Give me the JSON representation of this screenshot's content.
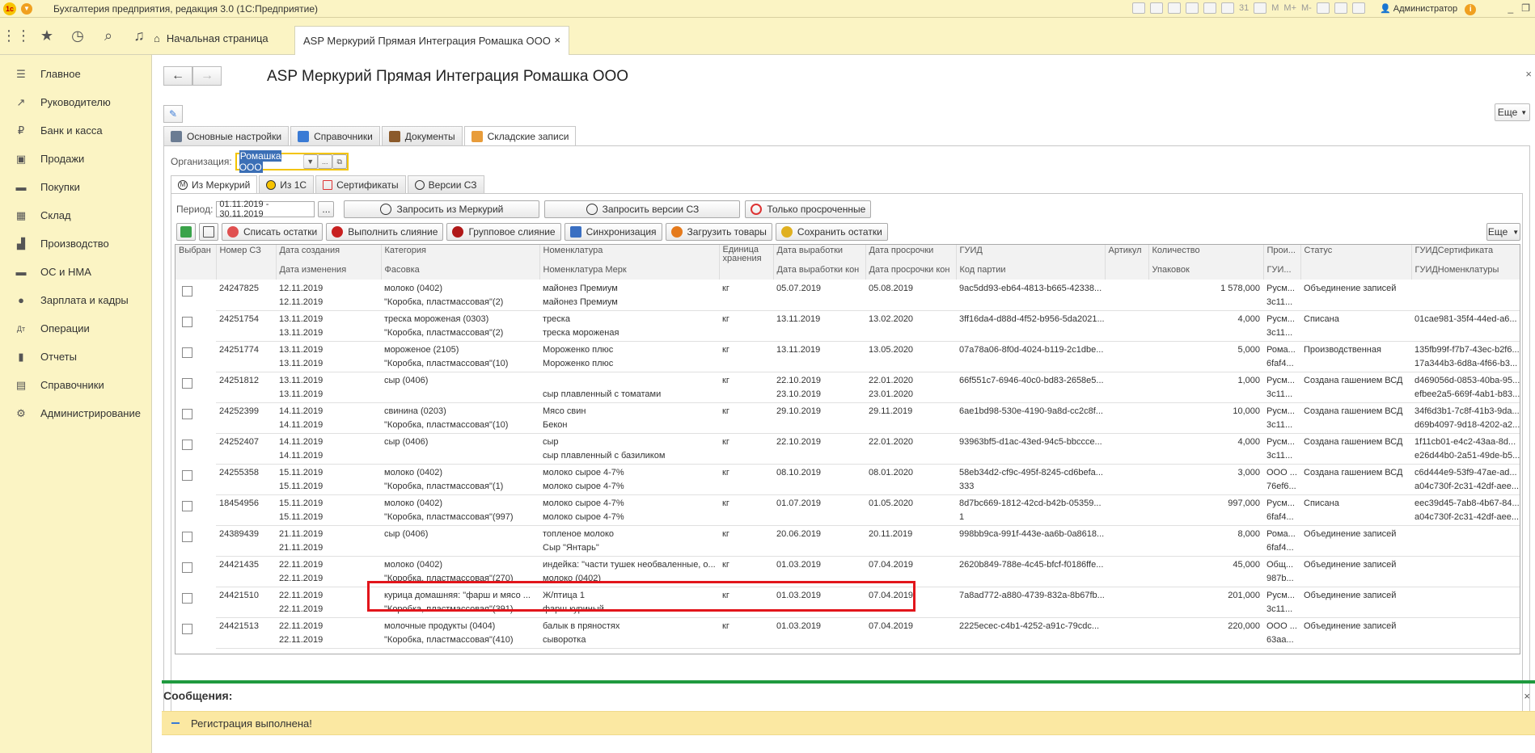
{
  "app": {
    "title": "Бухгалтерия предприятия, редакция 3.0  (1С:Предприятие)",
    "logo": "1с",
    "user": "Администратор",
    "mem_labels": [
      "M",
      "M+",
      "M-"
    ],
    "calendar": "31"
  },
  "tabs": {
    "home": "Начальная страница",
    "active": "ASP Меркурий Прямая Интеграция Ромашка ООО",
    "close": "×"
  },
  "sidebar": {
    "items": [
      {
        "label": "Главное",
        "icon": "☰"
      },
      {
        "label": "Руководителю",
        "icon": "↗"
      },
      {
        "label": "Банк и касса",
        "icon": "₽"
      },
      {
        "label": "Продажи",
        "icon": "▣"
      },
      {
        "label": "Покупки",
        "icon": "▬"
      },
      {
        "label": "Склад",
        "icon": "▦"
      },
      {
        "label": "Производство",
        "icon": "▟"
      },
      {
        "label": "ОС и НМА",
        "icon": "▬"
      },
      {
        "label": "Зарплата и кадры",
        "icon": "●"
      },
      {
        "label": "Операции",
        "icon": "Дт"
      },
      {
        "label": "Отчеты",
        "icon": "▮"
      },
      {
        "label": "Справочники",
        "icon": "▤"
      },
      {
        "label": "Администрирование",
        "icon": "⚙"
      }
    ]
  },
  "form": {
    "title": "ASP Меркурий Прямая Интеграция Ромашка ООО",
    "more_label": "Еще",
    "tabs": [
      "Основные настройки",
      "Справочники",
      "Документы",
      "Складские записи"
    ],
    "org_label": "Организация:",
    "org_value": "Ромашка ООО",
    "subtabs": [
      "Из Меркурий",
      "Из 1С",
      "Сертификаты",
      "Версии СЗ"
    ],
    "period_label": "Период:",
    "period_value": "01.11.2019 - 30.11.2019",
    "ellipsis": "...",
    "btn_request_mercury": "Запросить из Меркурий",
    "btn_request_versions": "Запросить версии СЗ",
    "btn_only_expired": "Только просроченные",
    "cmd": {
      "write_off": "Списать остатки",
      "merge": "Выполнить слияние",
      "group_merge": "Групповое слияние",
      "sync": "Синхронизация",
      "load_goods": "Загрузить товары",
      "save_remains": "Сохранить остатки",
      "more": "Еще"
    }
  },
  "grid": {
    "headers_top": [
      "Выбран",
      "Номер СЗ",
      "Дата создания",
      "Категория",
      "Номенклатура",
      "Единица хранения",
      "Дата выработки",
      "Дата просрочки",
      "ГУИД",
      "Артикул",
      "Количество",
      "Прои...",
      "Статус",
      "ГУИДСертификата"
    ],
    "headers_bottom": [
      "",
      "",
      "Дата изменения",
      "Фасовка",
      "Номенклатура Мерк",
      "",
      "Дата выработки кон",
      "Дата просрочки кон",
      "Код партии",
      "",
      "Упаковок",
      "ГУИ...",
      "",
      "ГУИДНоменклатуры"
    ],
    "rows": [
      {
        "a": [
          "24247825",
          "12.11.2019",
          "молоко (0402)",
          "майонез Премиум",
          "кг",
          "05.07.2019",
          "05.08.2019",
          "9ac5dd93-eb64-4813-b665-42338...",
          "",
          "1 578,000",
          "Русм...",
          "Объединение записей",
          ""
        ],
        "b": [
          "",
          "12.11.2019",
          "\"Коробка, пластмассовая\"(2)",
          "майонез Премиум",
          "",
          "",
          "",
          "",
          "",
          "",
          "3с11...",
          "",
          ""
        ]
      },
      {
        "a": [
          "24251754",
          "13.11.2019",
          "треска мороженая (0303)",
          "треска",
          "кг",
          "13.11.2019",
          "13.02.2020",
          "3ff16da4-d88d-4f52-b956-5da2021...",
          "",
          "4,000",
          "Русм...",
          "Списана",
          "01cae981-35f4-44ed-a6..."
        ],
        "b": [
          "",
          "13.11.2019",
          "\"Коробка, пластмассовая\"(2)",
          "треска мороженая",
          "",
          "",
          "",
          "",
          "",
          "",
          "3с11...",
          "",
          ""
        ]
      },
      {
        "a": [
          "24251774",
          "13.11.2019",
          "мороженое (2105)",
          "Мороженко плюс",
          "кг",
          "13.11.2019",
          "13.05.2020",
          "07a78a06-8f0d-4024-b119-2c1dbe...",
          "",
          "5,000",
          "Рома...",
          "Производственная",
          "135fb99f-f7b7-43ec-b2f6..."
        ],
        "b": [
          "",
          "13.11.2019",
          "\"Коробка, пластмассовая\"(10)",
          "Мороженко плюс",
          "",
          "",
          "",
          "",
          "",
          "",
          "6faf4...",
          "",
          "17a344b3-6d8a-4f66-b3..."
        ]
      },
      {
        "a": [
          "24251812",
          "13.11.2019",
          "сыр (0406)",
          "",
          "кг",
          "22.10.2019",
          "22.01.2020",
          "66f551c7-6946-40c0-bd83-2658e5...",
          "",
          "1,000",
          "Русм...",
          "Создана гашением ВСД",
          "d469056d-0853-40ba-95..."
        ],
        "b": [
          "",
          "13.11.2019",
          "",
          "сыр плавленный с томатами",
          "",
          "23.10.2019",
          "23.01.2020",
          "",
          "",
          "",
          "3с11...",
          "",
          "efbee2a5-669f-4ab1-b83..."
        ]
      },
      {
        "a": [
          "24252399",
          "14.11.2019",
          "свинина (0203)",
          "Мясо свин",
          "кг",
          "29.10.2019",
          "29.11.2019",
          "6ae1bd98-530e-4190-9a8d-cc2c8f...",
          "",
          "10,000",
          "Русм...",
          "Создана гашением ВСД",
          "34f6d3b1-7c8f-41b3-9da..."
        ],
        "b": [
          "",
          "14.11.2019",
          "\"Коробка, пластмассовая\"(10)",
          "Бекон",
          "",
          "",
          "",
          "",
          "",
          "",
          "3с11...",
          "",
          "d69b4097-9d18-4202-a2..."
        ]
      },
      {
        "a": [
          "24252407",
          "14.11.2019",
          "сыр (0406)",
          "сыр",
          "кг",
          "22.10.2019",
          "22.01.2020",
          "93963bf5-d1ac-43ed-94c5-bbccce...",
          "",
          "4,000",
          "Русм...",
          "Создана гашением ВСД",
          "1f11cb01-e4c2-43aa-8d..."
        ],
        "b": [
          "",
          "14.11.2019",
          "",
          "сыр плавленный с базиликом",
          "",
          "",
          "",
          "",
          "",
          "",
          "3с11...",
          "",
          "e26d44b0-2a51-49de-b5..."
        ]
      },
      {
        "a": [
          "24255358",
          "15.11.2019",
          "молоко (0402)",
          "молоко сырое 4-7%",
          "кг",
          "08.10.2019",
          "08.01.2020",
          "58eb34d2-cf9c-495f-8245-cd6befa...",
          "",
          "3,000",
          "ООО ...",
          "Создана гашением ВСД",
          "c6d444e9-53f9-47ae-ad..."
        ],
        "b": [
          "",
          "15.11.2019",
          "\"Коробка, пластмассовая\"(1)",
          "молоко сырое 4-7%",
          "",
          "",
          "",
          "333",
          "",
          "",
          "76ef6...",
          "",
          "a04c730f-2c31-42df-aee..."
        ]
      },
      {
        "a": [
          "18454956",
          "15.11.2019",
          "молоко (0402)",
          "молоко сырое 4-7%",
          "кг",
          "01.07.2019",
          "01.05.2020",
          "8d7bc669-1812-42cd-b42b-05359...",
          "",
          "997,000",
          "Русм...",
          "Списана",
          "eec39d45-7ab8-4b67-84..."
        ],
        "b": [
          "",
          "15.11.2019",
          "\"Коробка, пластмассовая\"(997)",
          "молоко сырое 4-7%",
          "",
          "",
          "",
          "1",
          "",
          "",
          "6faf4...",
          "",
          "a04c730f-2c31-42df-aee..."
        ]
      },
      {
        "a": [
          "24389439",
          "21.11.2019",
          "сыр (0406)",
          "топленое молоко",
          "кг",
          "20.06.2019",
          "20.11.2019",
          "998bb9ca-991f-443e-aa6b-0a8618...",
          "",
          "8,000",
          "Рома...",
          "Объединение записей",
          ""
        ],
        "b": [
          "",
          "21.11.2019",
          "",
          "Сыр \"Янтарь\"",
          "",
          "",
          "",
          "",
          "",
          "",
          "6faf4...",
          "",
          ""
        ]
      },
      {
        "a": [
          "24421435",
          "22.11.2019",
          "молоко (0402)",
          "индейка: \"части тушек необваленные, о...",
          "кг",
          "01.03.2019",
          "07.04.2019",
          "2620b849-788e-4c45-bfcf-f0186ffe...",
          "",
          "45,000",
          "Общ...",
          "Объединение записей",
          ""
        ],
        "b": [
          "",
          "22.11.2019",
          "\"Коробка, пластмассовая\"(270)",
          "молоко (0402)",
          "",
          "",
          "",
          "",
          "",
          "",
          "987b...",
          "",
          ""
        ]
      },
      {
        "a": [
          "24421510",
          "22.11.2019",
          "курица домашняя: \"фарш и мясо ...",
          "Ж/птица 1",
          "кг",
          "01.03.2019",
          "07.04.2019",
          "7a8ad772-a880-4739-832a-8b67fb...",
          "",
          "201,000",
          "Русм...",
          "Объединение записей",
          ""
        ],
        "b": [
          "",
          "22.11.2019",
          "\"Коробка, пластмассовая\"(391)",
          "фарш куриный",
          "",
          "",
          "",
          "",
          "",
          "",
          "3с11...",
          "",
          ""
        ]
      },
      {
        "a": [
          "24421513",
          "22.11.2019",
          "молочные продукты (0404)",
          "балык в пряностях",
          "кг",
          "01.03.2019",
          "07.04.2019",
          "2225ecec-c4b1-4252-a91c-79cdc...",
          "",
          "220,000",
          "ООО ...",
          "Объединение записей",
          ""
        ],
        "b": [
          "",
          "22.11.2019",
          "\"Коробка, пластмассовая\"(410)",
          "сыворотка",
          "",
          "",
          "",
          "",
          "",
          "",
          "63аа...",
          "",
          ""
        ]
      }
    ]
  },
  "messages": {
    "title": "Сообщения:",
    "close": "×",
    "item": "Регистрация выполнена!"
  }
}
